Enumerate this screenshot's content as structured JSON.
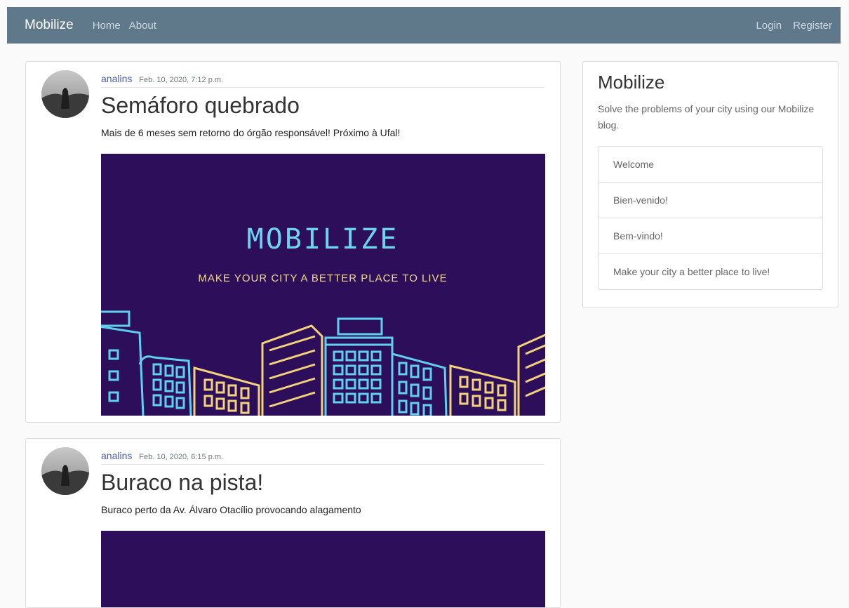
{
  "navbar": {
    "brand": "Mobilize",
    "links_left": [
      "Home",
      "About"
    ],
    "links_right": [
      "Login",
      "Register"
    ]
  },
  "posts": [
    {
      "author": "analins",
      "date": "Feb. 10, 2020, 7:12 p.m.",
      "title": "Semáforo quebrado",
      "content": "Mais de 6 meses sem retorno do órgão responsável! Próximo à Ufal!",
      "image": {
        "heading": "MOBILIZE",
        "tagline": "MAKE YOUR CITY A BETTER PLACE TO LIVE"
      }
    },
    {
      "author": "analins",
      "date": "Feb. 10, 2020, 6:15 p.m.",
      "title": "Buraco na pista!",
      "content": "Buraco perto da Av. Álvaro Otacílio provocando alagamento"
    }
  ],
  "sidebar": {
    "title": "Mobilize",
    "text": "Solve the problems of your city using our Mobilize blog.",
    "items": [
      "Welcome",
      "Bien-venido!",
      "Bem-vindo!",
      "Make your city a better place to live!"
    ]
  },
  "colors": {
    "navbar": "#5f788a",
    "image_bg": "#2d0e5b",
    "image_heading": "#6fd3ee",
    "image_tagline": "#f3dc8a",
    "building_blue": "#5fd0f0",
    "building_yellow": "#f2d27a"
  }
}
